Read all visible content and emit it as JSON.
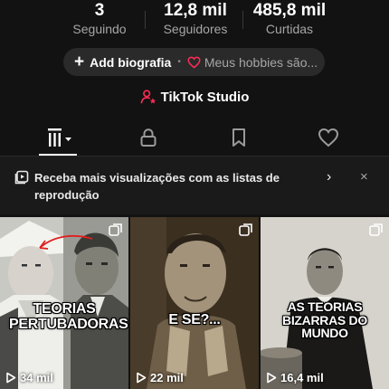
{
  "stats": [
    {
      "value": "3",
      "label": "Seguindo"
    },
    {
      "value": "12,8 mil",
      "label": "Seguidores"
    },
    {
      "value": "485,8 mil",
      "label": "Curtidas"
    }
  ],
  "bio": {
    "add_label": "Add biografia",
    "hobbies_text": "Meus hobbies são..."
  },
  "studio": {
    "label": "TikTok Studio"
  },
  "tabs": [
    "videos-grid-icon",
    "lock-icon",
    "bookmark-icon",
    "heart-icon"
  ],
  "banner": {
    "text": "Receba mais visualizações com as listas de reprodução",
    "arrow": "›",
    "close": "×"
  },
  "videos": [
    {
      "caption": "TEORIAS PERTUBADORAS",
      "views": "34 mil"
    },
    {
      "caption": "E SE?...",
      "views": "22 mil"
    },
    {
      "caption": "AS TEORIAS BIZARRAS DO MUNDO",
      "views": "16,4 mil"
    }
  ],
  "colors": {
    "background": "#121212",
    "accent": "#fe2c55",
    "secondary_text": "#a6a6a6"
  }
}
